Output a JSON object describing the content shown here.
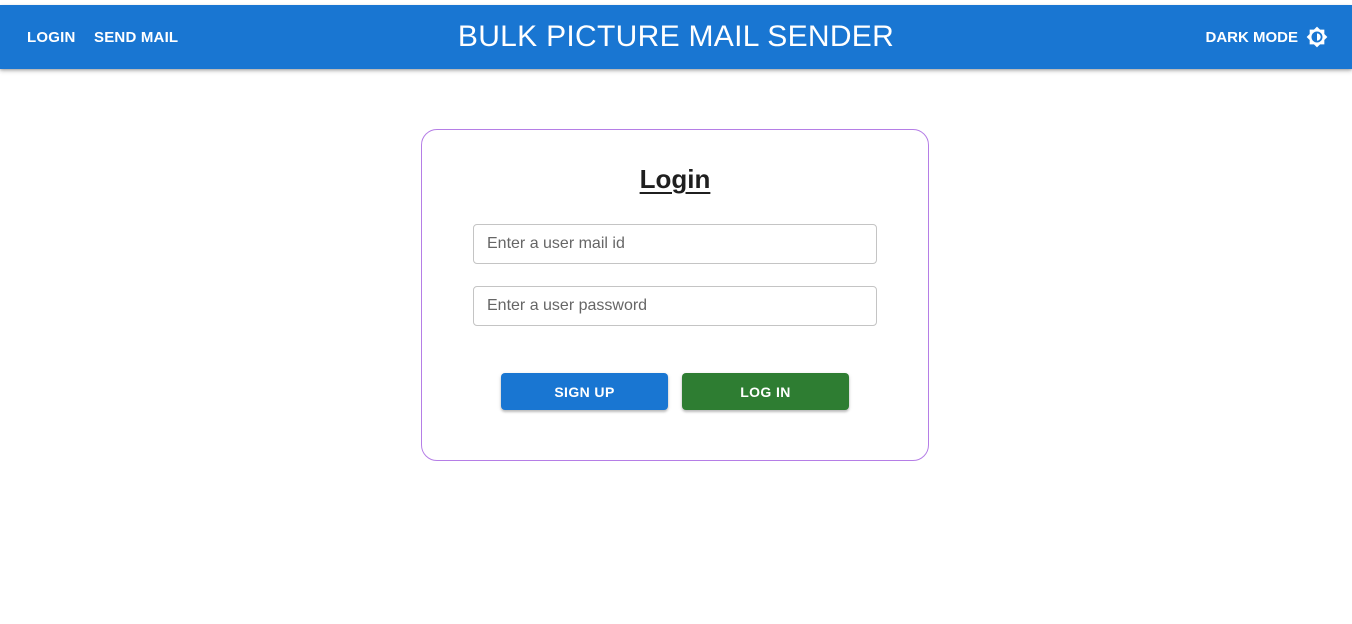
{
  "header": {
    "nav": {
      "login_label": "LOGIN",
      "send_mail_label": "SEND MAIL"
    },
    "title": "BULK PICTURE MAIL SENDER",
    "dark_mode_label": "DARK MODE",
    "dark_mode_icon": "brightness-icon"
  },
  "login_card": {
    "title": "Login",
    "email_placeholder": "Enter a user mail id",
    "email_value": "",
    "password_placeholder": "Enter a user password",
    "password_value": "",
    "signup_label": "SIGN UP",
    "login_label": "LOG IN"
  },
  "colors": {
    "appbar": "#1976d2",
    "signup_button": "#1976d2",
    "login_button": "#2e7d32",
    "card_border": "#b57ee6"
  }
}
